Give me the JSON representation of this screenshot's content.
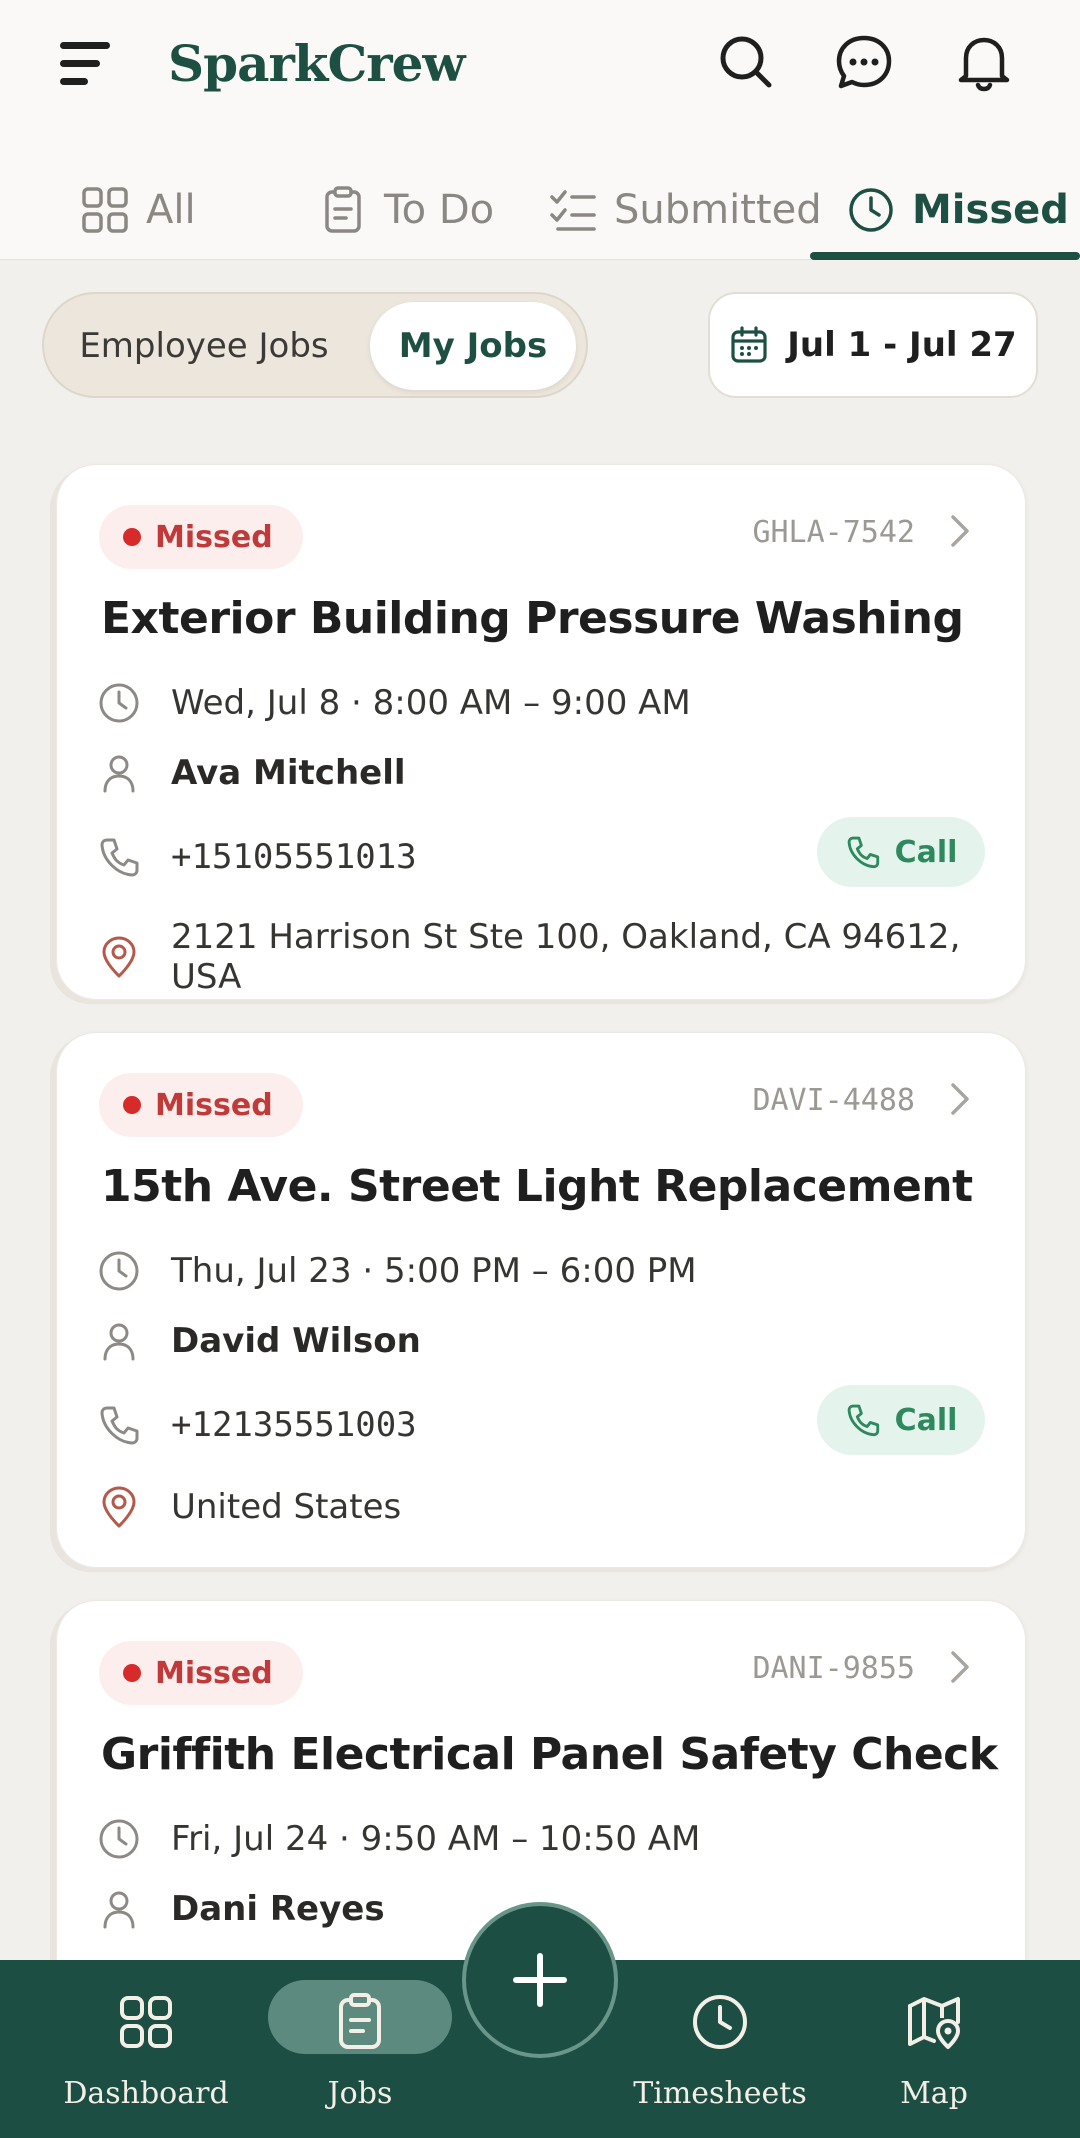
{
  "app": {
    "brand": "SparkCrew"
  },
  "header": {
    "icons": [
      "menu-icon",
      "search-icon",
      "chat-icon",
      "bell-icon"
    ]
  },
  "tabs": [
    {
      "label": "All",
      "icon": "grid-icon"
    },
    {
      "label": "To Do",
      "icon": "clipboard-icon"
    },
    {
      "label": "Submitted",
      "icon": "checklist-icon"
    },
    {
      "label": "Missed",
      "icon": "clock-icon",
      "active": true
    }
  ],
  "filter": {
    "segments": [
      "Employee Jobs",
      "My Jobs"
    ],
    "active_segment": "My Jobs",
    "date_range": "Jul 1 - Jul 27"
  },
  "jobs": [
    {
      "status": "Missed",
      "code": "GHLA-7542",
      "title": "Exterior Building Pressure Washing",
      "time": "Wed, Jul 8 · 8:00 AM – 9:00 AM",
      "customer": "Ava Mitchell",
      "phone": "+15105551013",
      "address": "2121 Harrison St Ste 100, Oakland, CA 94612, USA",
      "call_label": "Call"
    },
    {
      "status": "Missed",
      "code": "DAVI-4488",
      "title": "15th Ave. Street Light Replacement",
      "time": "Thu, Jul 23 · 5:00 PM – 6:00 PM",
      "customer": "David Wilson",
      "phone": "+12135551003",
      "address": "United States",
      "call_label": "Call"
    },
    {
      "status": "Missed",
      "code": "DANI-9855",
      "title": "Griffith Electrical Panel Safety Check",
      "time": "Fri, Jul 24 · 9:50 AM – 10:50 AM",
      "customer": "Dani Reyes"
    }
  ],
  "bottom_nav": [
    {
      "label": "Dashboard",
      "icon": "dashboard-icon"
    },
    {
      "label": "Jobs",
      "icon": "jobs-icon",
      "active": true
    },
    {
      "label": "Timesheets",
      "icon": "clock-icon"
    },
    {
      "label": "Map",
      "icon": "map-icon"
    }
  ],
  "colors": {
    "brand": "#1d5043",
    "nav_bg": "#1d4e43",
    "missed": "#c13a3a",
    "call": "#2e8a5e"
  }
}
